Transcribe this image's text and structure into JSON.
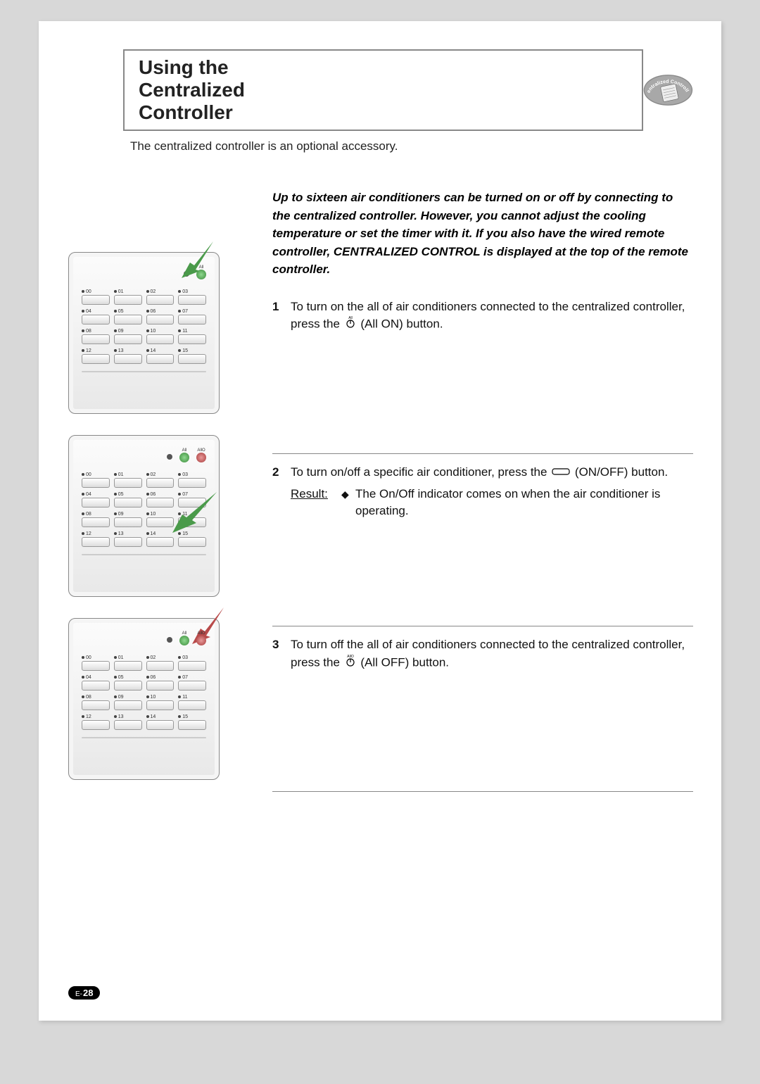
{
  "header": {
    "title": "Using the Centralized Controller",
    "badge_text": "Centralized Controller"
  },
  "subtitle": "The centralized controller is an optional accessory.",
  "lead": "Up to sixteen air conditioners can be turned on or off by connecting to the centralized controller. However, you cannot adjust the cooling temperature or set the timer with it. If you also have the wired remote controller, CENTRALIZED CONTROL is displayed at the top of the remote controller.",
  "steps": [
    {
      "num": "1",
      "text_before": "To turn on the all of air conditioners connected to the centralized controller, press the ",
      "icon": "all-on",
      "text_after": " (All ON) button."
    },
    {
      "num": "2",
      "text_before": "To turn on/off a specific air conditioner, press the ",
      "icon": "onoff",
      "text_after": " (ON/OFF) button.",
      "result_label": "Result:",
      "result_text": "The On/Off indicator comes on when the air conditioner is operating."
    },
    {
      "num": "3",
      "text_before": "To turn off the all of air conditioners connected to the centralized controller, press the ",
      "icon": "all-off",
      "text_after": " (All OFF) button."
    }
  ],
  "device_buttons": [
    "00",
    "01",
    "02",
    "03",
    "04",
    "05",
    "06",
    "07",
    "08",
    "09",
    "10",
    "11",
    "12",
    "13",
    "14",
    "15"
  ],
  "device_labels": {
    "all_on": "All",
    "all_off": "AllO"
  },
  "page_number_prefix": "E-",
  "page_number": "28"
}
